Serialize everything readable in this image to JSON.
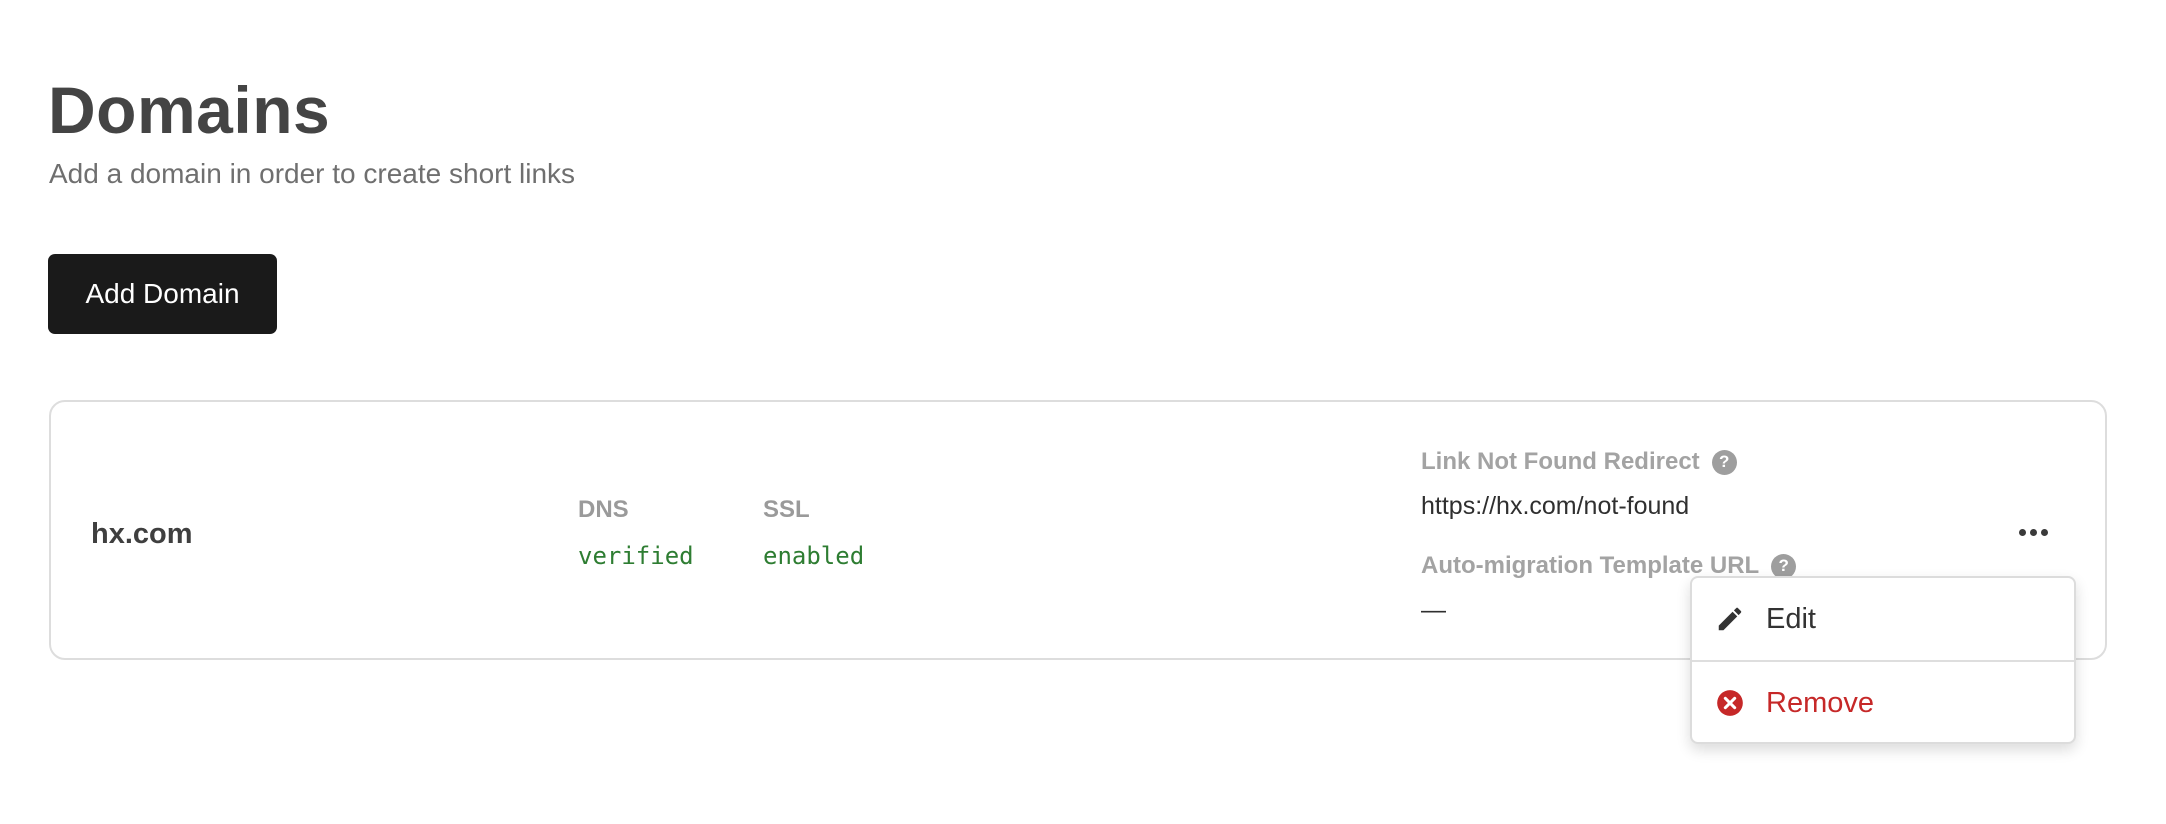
{
  "header": {
    "title": "Domains",
    "subtitle": "Add a domain in order to create short links"
  },
  "actions": {
    "add_domain_label": "Add Domain"
  },
  "domains": [
    {
      "name": "hx.com",
      "dns_label": "DNS",
      "dns_value": "verified",
      "ssl_label": "SSL",
      "ssl_value": "enabled",
      "redirect_label": "Link Not Found Redirect",
      "redirect_value": "https://hx.com/not-found",
      "template_label": "Auto-migration Template URL",
      "template_value": "—"
    }
  ],
  "menu": {
    "edit_label": "Edit",
    "remove_label": "Remove"
  },
  "icons": {
    "help": "help-icon",
    "more": "ellipsis-icon",
    "edit": "pencil-icon",
    "remove": "close-circle-icon"
  },
  "colors": {
    "primary_button_bg": "#1a1a1a",
    "status_green": "#2e7d32",
    "danger_red": "#c62828",
    "help_icon_bg": "#9e9e9e"
  }
}
